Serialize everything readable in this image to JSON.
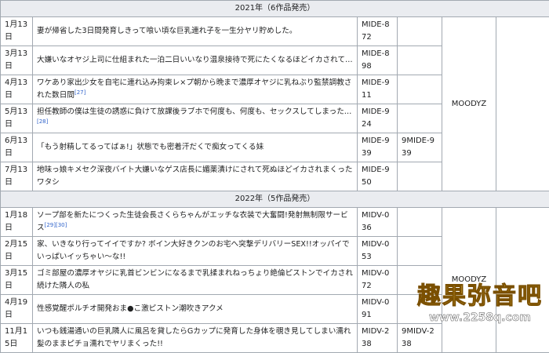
{
  "sections": [
    {
      "header": "2021年（6作品発売）",
      "label": "MOODYZ",
      "rows": [
        {
          "date": "1月13日",
          "title": "妻が帰省した3日間発育しきって喰い頃な巨乳連れ子を一生分ヤリ貯めした。",
          "refs": "",
          "code": "MIDE-872",
          "code2": ""
        },
        {
          "date": "3月13日",
          "title": "大嫌いなオヤジ上司に仕組まれた一泊二日いいなり温泉接待で死にたくなるほどイカされて…",
          "refs": "",
          "code": "MIDE-898",
          "code2": ""
        },
        {
          "date": "4月13日",
          "title": "ワケあり家出少女を自宅に連れ込み拘束レ×プ朝から晩まで濃厚オヤジに乳ねぶり監禁調教された数日間",
          "refs": "[27]",
          "code": "MIDE-911",
          "code2": ""
        },
        {
          "date": "5月13日",
          "title": "担任教師の僕は生徒の誘惑に負けて放課後ラブホで何度も、何度も、セックスしてしまった…",
          "refs": "[28]",
          "code": "MIDE-924",
          "code2": ""
        },
        {
          "date": "6月13日",
          "title": "「もう射精してるってばぁ!」状態でも密着汗だくで痴女ってくる妹",
          "refs": "",
          "code": "MIDE-939",
          "code2": "9MIDE-939"
        },
        {
          "date": "7月13日",
          "title": "地味っ娘キメセク深夜バイト大嫌いなゲス店長に媚薬漬けにされて死ぬほどイカされまくったワタシ",
          "refs": "",
          "code": "MIDE-950",
          "code2": ""
        }
      ]
    },
    {
      "header": "2022年（5作品発売）",
      "label": "MOODYZ",
      "rows": [
        {
          "date": "1月18日",
          "title": "ソープ部を新たにつくった生徒会長さくらちゃんがエッチな衣装で大奮闘!発射無制限サービス",
          "refs": "[29][30]",
          "code": "MIDV-036",
          "code2": ""
        },
        {
          "date": "2月15日",
          "title": "家、いきなり行ってイイですか? ボイン大好きクンのお宅へ突撃デリバリーSEX!!オッパイでいっぱいイッちゃい～な!!",
          "refs": "",
          "code": "MIDV-053",
          "code2": ""
        },
        {
          "date": "3月15日",
          "title": "ゴミ部屋の濃厚オヤジに乳首ビンビンになるまで乳揉まれねっちょり絶倫ピストンでイカされ続けた隣人の私",
          "refs": "",
          "code": "MIDV-072",
          "code2": ""
        },
        {
          "date": "4月19日",
          "title": "性感覚醒ポルチオ開発おま●こ激ピストン潮吹きアクメ",
          "refs": "",
          "code": "MIDV-091",
          "code2": ""
        },
        {
          "date": "11月15日",
          "title": "いつも銭湯通いの巨乳隣人に風呂を貸したらGカップに発育した身体を覗き見してしまい濡れ髪のままピチョ濡れでヤリまくった!!",
          "refs": "",
          "code": "MIDV-238",
          "code2": "9MIDV-238"
        }
      ]
    }
  ],
  "watermark": {
    "text": "趣果弥音吧",
    "url": "www.2258q.com"
  }
}
